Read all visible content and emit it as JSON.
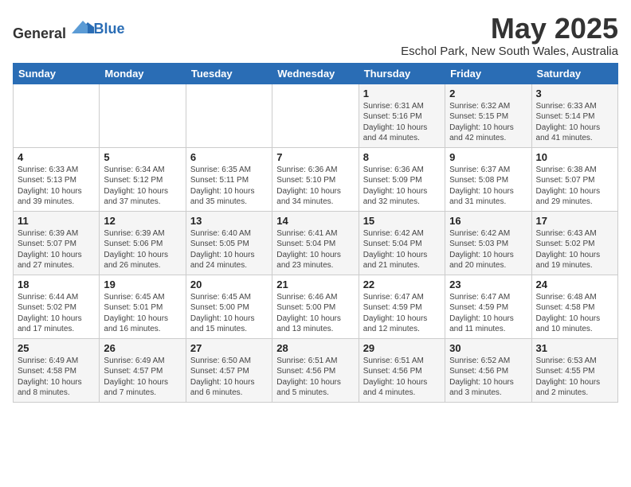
{
  "header": {
    "logo_general": "General",
    "logo_blue": "Blue",
    "title": "May 2025",
    "subtitle": "Eschol Park, New South Wales, Australia"
  },
  "weekdays": [
    "Sunday",
    "Monday",
    "Tuesday",
    "Wednesday",
    "Thursday",
    "Friday",
    "Saturday"
  ],
  "weeks": [
    [
      {
        "day": "",
        "sunrise": "",
        "sunset": "",
        "daylight": ""
      },
      {
        "day": "",
        "sunrise": "",
        "sunset": "",
        "daylight": ""
      },
      {
        "day": "",
        "sunrise": "",
        "sunset": "",
        "daylight": ""
      },
      {
        "day": "",
        "sunrise": "",
        "sunset": "",
        "daylight": ""
      },
      {
        "day": "1",
        "sunrise": "Sunrise: 6:31 AM",
        "sunset": "Sunset: 5:16 PM",
        "daylight": "Daylight: 10 hours and 44 minutes."
      },
      {
        "day": "2",
        "sunrise": "Sunrise: 6:32 AM",
        "sunset": "Sunset: 5:15 PM",
        "daylight": "Daylight: 10 hours and 42 minutes."
      },
      {
        "day": "3",
        "sunrise": "Sunrise: 6:33 AM",
        "sunset": "Sunset: 5:14 PM",
        "daylight": "Daylight: 10 hours and 41 minutes."
      }
    ],
    [
      {
        "day": "4",
        "sunrise": "Sunrise: 6:33 AM",
        "sunset": "Sunset: 5:13 PM",
        "daylight": "Daylight: 10 hours and 39 minutes."
      },
      {
        "day": "5",
        "sunrise": "Sunrise: 6:34 AM",
        "sunset": "Sunset: 5:12 PM",
        "daylight": "Daylight: 10 hours and 37 minutes."
      },
      {
        "day": "6",
        "sunrise": "Sunrise: 6:35 AM",
        "sunset": "Sunset: 5:11 PM",
        "daylight": "Daylight: 10 hours and 35 minutes."
      },
      {
        "day": "7",
        "sunrise": "Sunrise: 6:36 AM",
        "sunset": "Sunset: 5:10 PM",
        "daylight": "Daylight: 10 hours and 34 minutes."
      },
      {
        "day": "8",
        "sunrise": "Sunrise: 6:36 AM",
        "sunset": "Sunset: 5:09 PM",
        "daylight": "Daylight: 10 hours and 32 minutes."
      },
      {
        "day": "9",
        "sunrise": "Sunrise: 6:37 AM",
        "sunset": "Sunset: 5:08 PM",
        "daylight": "Daylight: 10 hours and 31 minutes."
      },
      {
        "day": "10",
        "sunrise": "Sunrise: 6:38 AM",
        "sunset": "Sunset: 5:07 PM",
        "daylight": "Daylight: 10 hours and 29 minutes."
      }
    ],
    [
      {
        "day": "11",
        "sunrise": "Sunrise: 6:39 AM",
        "sunset": "Sunset: 5:07 PM",
        "daylight": "Daylight: 10 hours and 27 minutes."
      },
      {
        "day": "12",
        "sunrise": "Sunrise: 6:39 AM",
        "sunset": "Sunset: 5:06 PM",
        "daylight": "Daylight: 10 hours and 26 minutes."
      },
      {
        "day": "13",
        "sunrise": "Sunrise: 6:40 AM",
        "sunset": "Sunset: 5:05 PM",
        "daylight": "Daylight: 10 hours and 24 minutes."
      },
      {
        "day": "14",
        "sunrise": "Sunrise: 6:41 AM",
        "sunset": "Sunset: 5:04 PM",
        "daylight": "Daylight: 10 hours and 23 minutes."
      },
      {
        "day": "15",
        "sunrise": "Sunrise: 6:42 AM",
        "sunset": "Sunset: 5:04 PM",
        "daylight": "Daylight: 10 hours and 21 minutes."
      },
      {
        "day": "16",
        "sunrise": "Sunrise: 6:42 AM",
        "sunset": "Sunset: 5:03 PM",
        "daylight": "Daylight: 10 hours and 20 minutes."
      },
      {
        "day": "17",
        "sunrise": "Sunrise: 6:43 AM",
        "sunset": "Sunset: 5:02 PM",
        "daylight": "Daylight: 10 hours and 19 minutes."
      }
    ],
    [
      {
        "day": "18",
        "sunrise": "Sunrise: 6:44 AM",
        "sunset": "Sunset: 5:02 PM",
        "daylight": "Daylight: 10 hours and 17 minutes."
      },
      {
        "day": "19",
        "sunrise": "Sunrise: 6:45 AM",
        "sunset": "Sunset: 5:01 PM",
        "daylight": "Daylight: 10 hours and 16 minutes."
      },
      {
        "day": "20",
        "sunrise": "Sunrise: 6:45 AM",
        "sunset": "Sunset: 5:00 PM",
        "daylight": "Daylight: 10 hours and 15 minutes."
      },
      {
        "day": "21",
        "sunrise": "Sunrise: 6:46 AM",
        "sunset": "Sunset: 5:00 PM",
        "daylight": "Daylight: 10 hours and 13 minutes."
      },
      {
        "day": "22",
        "sunrise": "Sunrise: 6:47 AM",
        "sunset": "Sunset: 4:59 PM",
        "daylight": "Daylight: 10 hours and 12 minutes."
      },
      {
        "day": "23",
        "sunrise": "Sunrise: 6:47 AM",
        "sunset": "Sunset: 4:59 PM",
        "daylight": "Daylight: 10 hours and 11 minutes."
      },
      {
        "day": "24",
        "sunrise": "Sunrise: 6:48 AM",
        "sunset": "Sunset: 4:58 PM",
        "daylight": "Daylight: 10 hours and 10 minutes."
      }
    ],
    [
      {
        "day": "25",
        "sunrise": "Sunrise: 6:49 AM",
        "sunset": "Sunset: 4:58 PM",
        "daylight": "Daylight: 10 hours and 8 minutes."
      },
      {
        "day": "26",
        "sunrise": "Sunrise: 6:49 AM",
        "sunset": "Sunset: 4:57 PM",
        "daylight": "Daylight: 10 hours and 7 minutes."
      },
      {
        "day": "27",
        "sunrise": "Sunrise: 6:50 AM",
        "sunset": "Sunset: 4:57 PM",
        "daylight": "Daylight: 10 hours and 6 minutes."
      },
      {
        "day": "28",
        "sunrise": "Sunrise: 6:51 AM",
        "sunset": "Sunset: 4:56 PM",
        "daylight": "Daylight: 10 hours and 5 minutes."
      },
      {
        "day": "29",
        "sunrise": "Sunrise: 6:51 AM",
        "sunset": "Sunset: 4:56 PM",
        "daylight": "Daylight: 10 hours and 4 minutes."
      },
      {
        "day": "30",
        "sunrise": "Sunrise: 6:52 AM",
        "sunset": "Sunset: 4:56 PM",
        "daylight": "Daylight: 10 hours and 3 minutes."
      },
      {
        "day": "31",
        "sunrise": "Sunrise: 6:53 AM",
        "sunset": "Sunset: 4:55 PM",
        "daylight": "Daylight: 10 hours and 2 minutes."
      }
    ]
  ]
}
